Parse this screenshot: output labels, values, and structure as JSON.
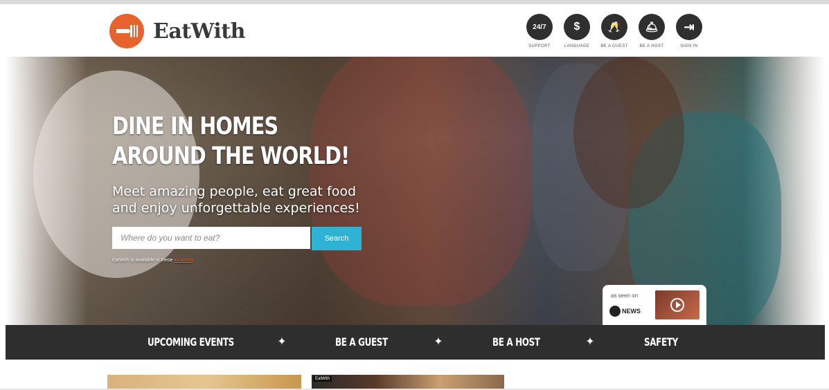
{
  "brand": {
    "name": "EatWith",
    "accent": "#e8632b"
  },
  "header_nav": [
    {
      "label": "SUPPORT",
      "icon": "clock-24-7-icon",
      "glyph": "24/7"
    },
    {
      "label": "LANGUAGE",
      "icon": "dollar-currency-icon",
      "glyph": "$"
    },
    {
      "label": "BE A GUEST",
      "icon": "glasses-icon",
      "glyph": "🥂"
    },
    {
      "label": "BE A HOST",
      "icon": "cloche-icon",
      "glyph": "🛎"
    },
    {
      "label": "SIGN IN",
      "icon": "sign-in-icon",
      "glyph": "⇥"
    }
  ],
  "hero": {
    "title_line1": "DINE IN HOMES",
    "title_line2": "AROUND THE WORLD!",
    "subtitle_line1": "Meet amazing people, eat great food",
    "subtitle_line2": "and enjoy unforgettable experiences!",
    "search": {
      "placeholder": "Where do you want to eat?",
      "button_label": "Search"
    },
    "availability_text": "EatWith is available in these",
    "availability_link": "locations",
    "press": {
      "label": "as seen on",
      "logo_text": "NEWS"
    }
  },
  "main_nav": [
    "UPCOMING EVENTS",
    "BE A GUEST",
    "BE A HOST",
    "SAFETY"
  ],
  "cards": [
    {
      "tag": ""
    },
    {
      "tag": "EatWith"
    }
  ],
  "colors": {
    "navbar": "#2e2e2e",
    "search_button": "#2fb3d5"
  }
}
